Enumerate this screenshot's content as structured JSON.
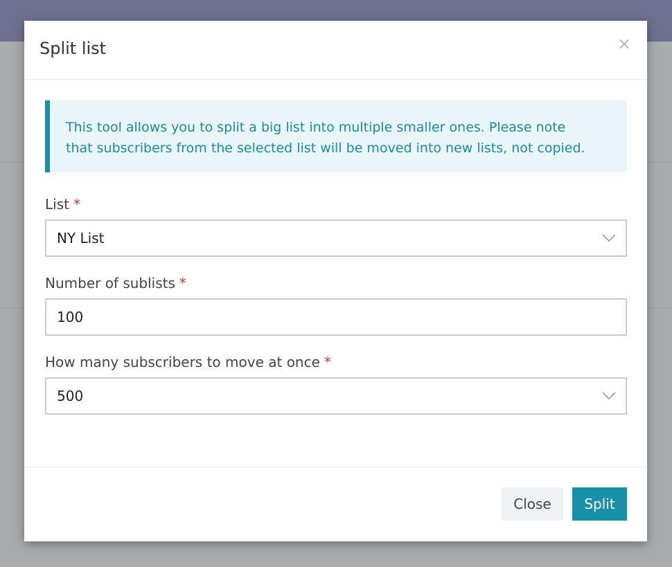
{
  "modal": {
    "title": "Split list",
    "close_glyph": "×",
    "info_line1": "This tool allows you to split a big list into multiple smaller ones. Please note",
    "info_line2": "that subscribers from the selected list will be moved into new lists, not copied."
  },
  "fields": {
    "list": {
      "label": "List",
      "required": "*",
      "value": "NY List"
    },
    "sublists": {
      "label": "Number of sublists",
      "required": "*",
      "value": "100"
    },
    "batch": {
      "label": "How many subscribers to move at once",
      "required": "*",
      "value": "500"
    }
  },
  "buttons": {
    "close": "Close",
    "split": "Split"
  },
  "colors": {
    "accent": "#1790a8",
    "required": "#b5443a",
    "topbar": "#6e7090"
  },
  "icons": {
    "close": "close-icon",
    "dropdown": "chevron-down-icon"
  }
}
